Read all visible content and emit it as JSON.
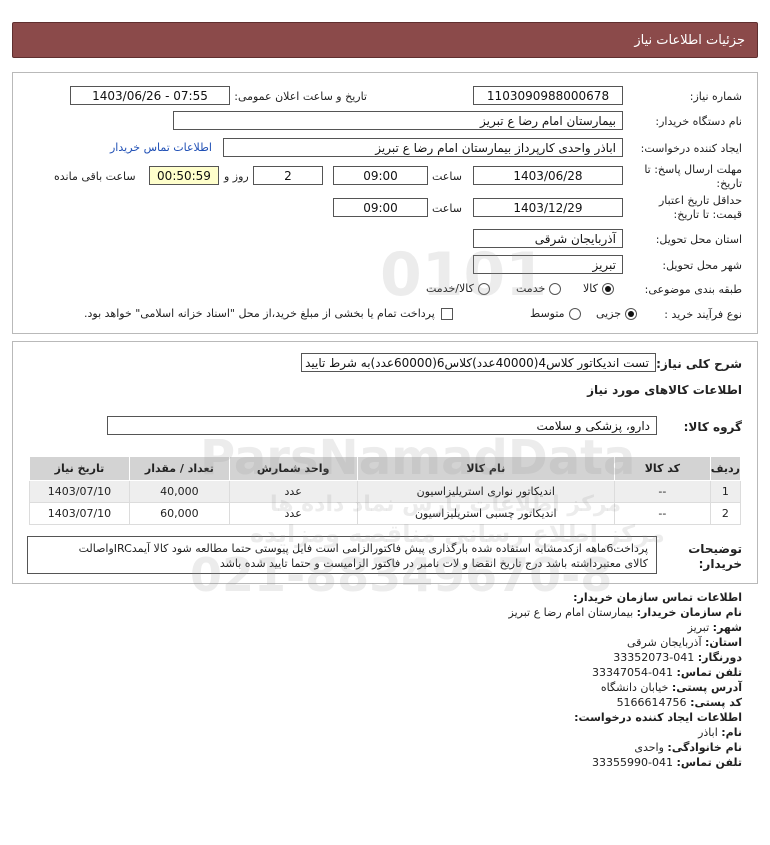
{
  "header": {
    "title": "جزئیات اطلاعات نیاز"
  },
  "form": {
    "need_number_label": "شماره نیاز:",
    "need_number": "1103090988000678",
    "announce_label": "تاریخ و ساعت اعلان عمومی:",
    "announce_value": "1403/06/26 - 07:55",
    "buyer_org_label": "نام دستگاه خریدار:",
    "buyer_org": "بیمارستان امام رضا  ع  تبریز",
    "creator_label": "ایجاد کننده درخواست:",
    "creator": "اباذر واحدی کارپرداز بیمارستان امام رضا  ع  تبریز",
    "contact_link": "اطلاعات تماس خریدار",
    "deadline_label_1": "مهلت ارسال پاسخ: تا",
    "deadline_label_2": "تاریخ:",
    "deadline_date": "1403/06/28",
    "time_label": "ساعت",
    "deadline_time": "09:00",
    "days_value": "2",
    "days_label": "روز و",
    "remaining_time": "00:50:59",
    "remaining_label": "ساعت باقی مانده",
    "validity_label_1": "حداقل تاریخ اعتبار",
    "validity_label_2": "قیمت: تا تاریخ:",
    "validity_date": "1403/12/29",
    "validity_time": "09:00",
    "delivery_province_label": "استان محل تحویل:",
    "delivery_province": "آذربایجان شرقی",
    "delivery_city_label": "شهر محل تحویل:",
    "delivery_city": "تبریز",
    "category_label": "طبقه بندی موضوعی:",
    "category_options": [
      "کالا",
      "خدمت",
      "کالا/خدمت"
    ],
    "category_selected": "کالا",
    "process_label": "نوع فرآیند خرید :",
    "process_options": [
      "جزیی",
      "متوسط"
    ],
    "process_selected": "جزیی",
    "payment_note": "پرداخت تمام یا بخشی از مبلغ خرید،از محل \"اسناد خزانه اسلامی\" خواهد بود."
  },
  "description": {
    "summary_label": "شرح کلی نیاز:",
    "summary": "تست اندیکاتور کلاس4(40000عدد)کلاس6(60000عدد)به شرط تایید",
    "goods_info_title": "اطلاعات کالاهای مورد نیاز",
    "goods_group_label": "گروه کالا:",
    "goods_group": "دارو، پزشکی و سلامت"
  },
  "table": {
    "headers": [
      "ردیف",
      "کد کالا",
      "نام کالا",
      "واحد شمارش",
      "تعداد / مقدار",
      "تاریخ نیاز"
    ],
    "rows": [
      [
        "1",
        "--",
        "اندیکاتور نواری استریلیزاسیون",
        "عدد",
        "40,000",
        "1403/07/10"
      ],
      [
        "2",
        "--",
        "اندیکاتور چسبی استریلیزاسیون",
        "عدد",
        "60,000",
        "1403/07/10"
      ]
    ]
  },
  "buyer_notes": {
    "label_1": "توضیحات",
    "label_2": "خریدار:",
    "text_1": "پرداخت6ماهه ازکدمشابه استفاده شده بارگذاری پیش فاکتورالزامی است فایل پیوستی حتما مطالعه شود کالا آیمدIRCواصالت",
    "text_2": "کالای معتبرداشته باشد درج تاریخ انقضا و لات نامبر در فاکتور الزامیست و حتما تایید شده باشد"
  },
  "contact": {
    "title": "اطلاعات تماس سازمان خریدار:",
    "org_label": "نام سازمان خریدار:",
    "org": "بیمارستان امام رضا ع تبریز",
    "city_label": "شهر:",
    "city": "تبریز",
    "province_label": "استان:",
    "province": "آذربایجان شرقی",
    "fax_label": "دورنگار:",
    "fax": "041-33352073",
    "phone_label": "تلفن تماس:",
    "phone": "041-33347054",
    "address_label": "آدرس پستی:",
    "address": "خیابان دانشگاه",
    "postal_label": "کد پستی:",
    "postal": "5166614756",
    "creator_title": "اطلاعات ایجاد کننده درخواست:",
    "name_label": "نام:",
    "name": "اباذر",
    "family_label": "نام خانوادگی:",
    "family": "واحدی",
    "creator_phone_label": "تلفن تماس:",
    "creator_phone": "041-33355990"
  },
  "watermark": {
    "brand": "ParsNamadData",
    "tagline": "مرکز اطلاعات پارس نماد داده ها",
    "sub": "مرکز اطلاع رسانی مناقصه ومزایده",
    "phone": "021-88349670-8",
    "num": "0101"
  }
}
